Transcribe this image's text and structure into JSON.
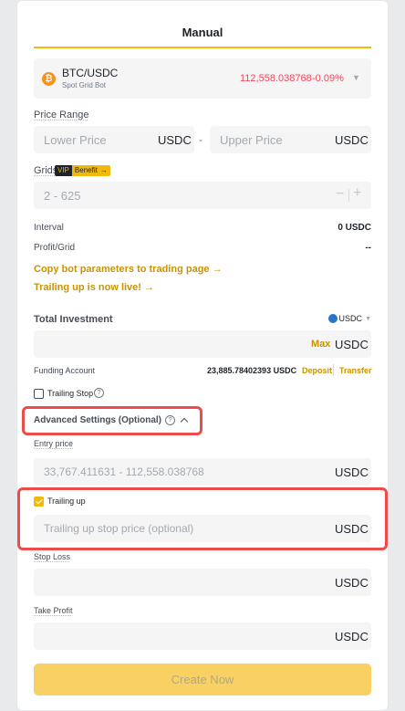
{
  "tab": {
    "label": "Manual"
  },
  "pair": {
    "name": "BTC/USDC",
    "subtitle": "Spot Grid Bot",
    "price": "112,558.038768",
    "change": "-0.09%"
  },
  "price_range": {
    "label": "Price Range",
    "lower_placeholder": "Lower Price",
    "upper_placeholder": "Upper Price",
    "unit": "USDC",
    "separator": "-"
  },
  "grids": {
    "label": "Grids",
    "vip": "VIP",
    "benefit": "Benefit",
    "arrow": "→",
    "placeholder": "2 - 625",
    "minus": "−",
    "plus": "+"
  },
  "interval": {
    "label": "Interval",
    "value": "0 USDC"
  },
  "profit_grid": {
    "label": "Profit/Grid",
    "value": "--"
  },
  "links": {
    "copy_params": "Copy bot parameters to trading page →",
    "trailing_live": "Trailing up is now live! →"
  },
  "investment": {
    "label": "Total Investment",
    "currency": "USDC",
    "max": "Max",
    "unit": "USDC"
  },
  "funding": {
    "label": "Funding Account",
    "amount": "23,885.78402393 USDC",
    "deposit": "Deposit",
    "transfer": "Transfer"
  },
  "trailing_stop": {
    "label": "Trailing Stop",
    "checked": false
  },
  "advanced": {
    "label": "Advanced Settings (Optional)"
  },
  "entry_price": {
    "label": "Entry price",
    "placeholder": "33,767.411631 - 112,558.038768",
    "unit": "USDC"
  },
  "trailing_up": {
    "label": "Trailing up",
    "checked": true,
    "placeholder": "Trailing up stop price (optional)",
    "unit": "USDC"
  },
  "stop_loss": {
    "label": "Stop Loss",
    "unit": "USDC"
  },
  "take_profit": {
    "label": "Take Profit",
    "unit": "USDC"
  },
  "create_button": {
    "label": "Create Now"
  },
  "colors": {
    "accent": "#f0b90b",
    "link": "#c99400",
    "negative": "#f6465d",
    "highlight": "#ee4b4b",
    "button_disabled": "#f8d064"
  }
}
